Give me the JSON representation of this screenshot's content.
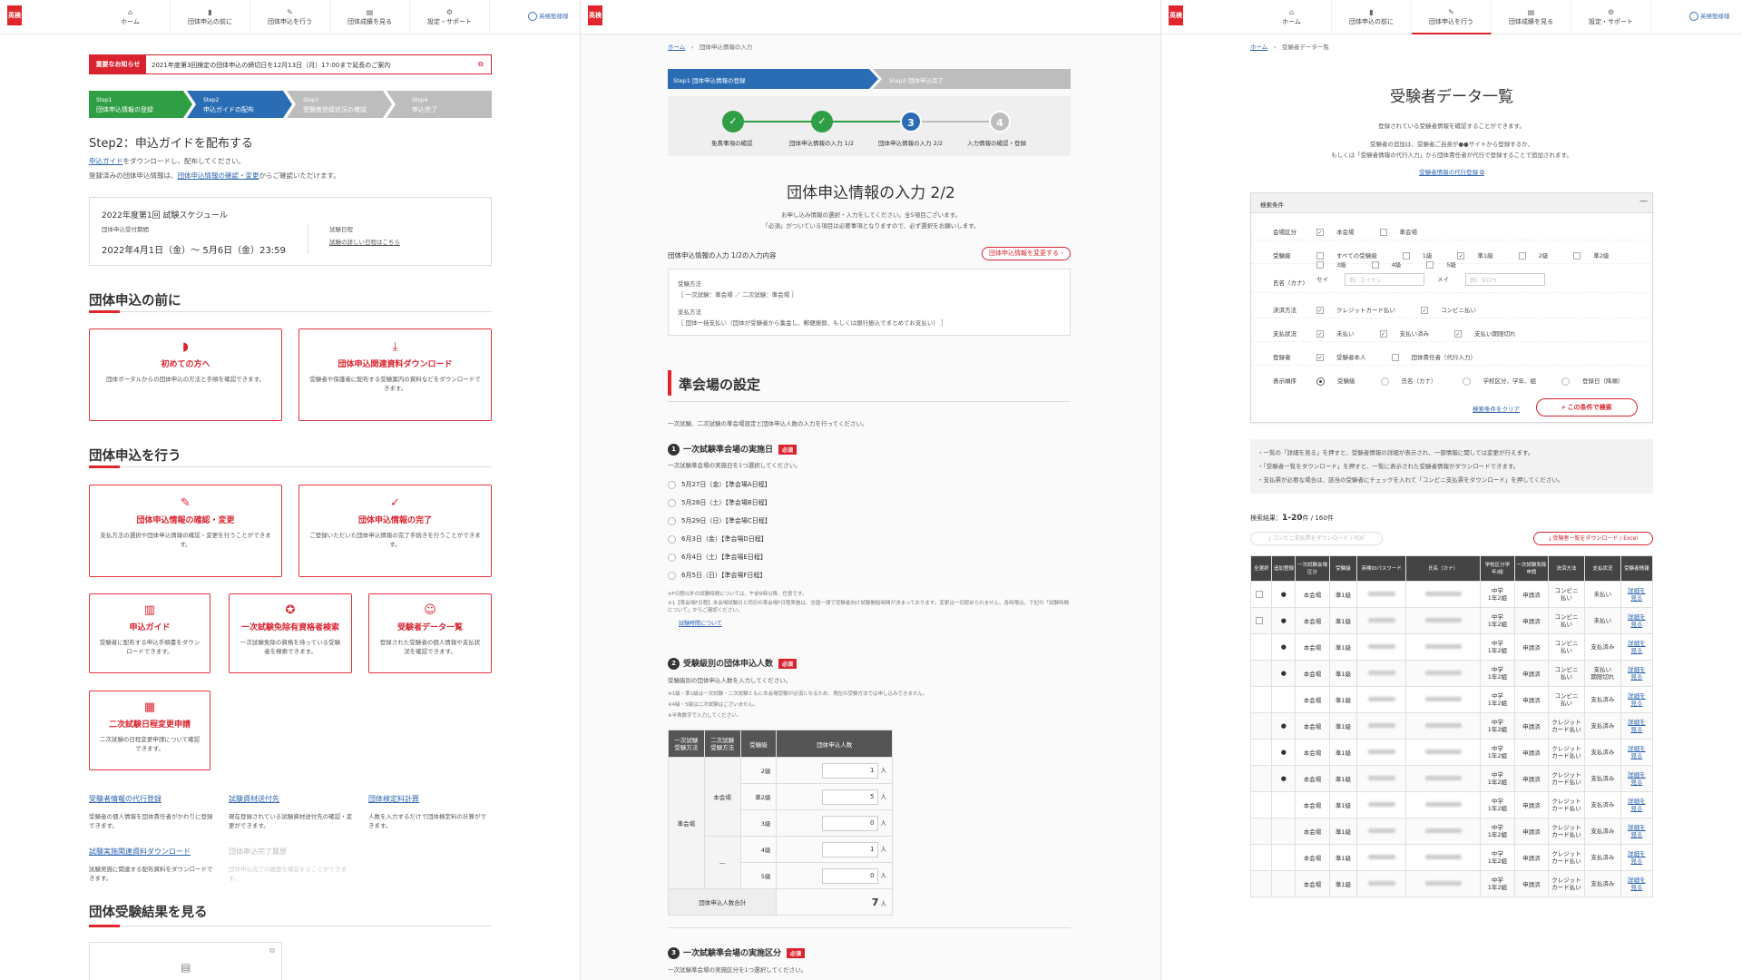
{
  "header": {
    "logo": "英検",
    "nav": [
      {
        "label": "ホーム",
        "icon": "home-icon",
        "glyph": "⌂"
      },
      {
        "label": "団体申込の前に",
        "icon": "book-icon",
        "glyph": "▮"
      },
      {
        "label": "団体申込を行う",
        "icon": "edit-icon",
        "glyph": "✎"
      },
      {
        "label": "団体成績を見る",
        "icon": "clipboard-icon",
        "glyph": "▤"
      },
      {
        "label": "設定・サポート",
        "icon": "gear-icon",
        "glyph": "⚙"
      }
    ],
    "user": "英検塾様様"
  },
  "p1": {
    "notice_label": "重要なお知らせ",
    "notice_msg": "2021年度第3回検定の団体申込の締切日を12月13日（月）17:00まで延長のご案内",
    "steps": [
      {
        "num": "Step1",
        "label": "団体申込情報の登録"
      },
      {
        "num": "Step2",
        "label": "申込ガイドの配布"
      },
      {
        "num": "Step3",
        "label": "受験者登録状況の確認"
      },
      {
        "num": "Step4",
        "label": "申込完了"
      }
    ],
    "title": "Step2：申込ガイドを配布する",
    "line1_link": "申込ガイド",
    "line1_rest": "をダウンロードし、配布してください。",
    "line2_pre": "登録済みの団体申込情報は、",
    "line2_link": "団体申込情報の確認・変更",
    "line2_post": "からご確認いただけます。",
    "sched_title": "2022年度第1回 試験スケジュール",
    "sched_period_label": "団体申込受付期間",
    "sched_period": "2022年4月1日（金）～ 5月6日（金）23:59",
    "sched_exam_label": "試験日程",
    "sched_exam_link": "試験の詳しい日程はこちら",
    "sec1": "団体申込の前に",
    "cards1": [
      {
        "label": "初めての方へ",
        "desc": "団体ポータルからの団体申込の方法と手順を確認できます。",
        "icon": "◗"
      },
      {
        "label": "団体申込関連資料ダウンロード",
        "desc": "受験者や保護者に配布する受験案内の資料などをダウンロードできます。",
        "icon": "⤓"
      }
    ],
    "sec2": "団体申込を行う",
    "cards2": [
      {
        "label": "団体申込情報の確認・変更",
        "desc": "支払方法の選択や団体申込情報の確認・変更を行うことができます。",
        "icon": "✎"
      },
      {
        "label": "団体申込情報の完了",
        "desc": "ご登録いただいた団体申込情報の完了手続きを行うことができます。",
        "icon": "✓"
      }
    ],
    "cards3": [
      {
        "label": "申込ガイド",
        "desc": "受験者に配布する申込手順書をダウンロードできます。",
        "icon": "▥"
      },
      {
        "label": "一次試験免除有資格者検索",
        "desc": "一次試験免除の資格を持っている受験者を検索できます。",
        "icon": "✪"
      },
      {
        "label": "受験者データ一覧",
        "desc": "登録された受験者の個人情報や支払状況を確認できます。",
        "icon": "☺"
      }
    ],
    "card4": {
      "label": "二次試験日程変更申請",
      "desc": "二次試験の日程変更申請について確認できます。",
      "icon": "▦"
    },
    "links": [
      {
        "label": "受験者情報の代行登録",
        "desc": "受験者の個人情報を団体責任者がかわりに登録できます。"
      },
      {
        "label": "試験資材送付先",
        "desc": "現在登録されている試験資材送付先の確認・変更ができます。"
      },
      {
        "label": "団体検定料計算",
        "desc": "人数を入力するだけで団体検定料の計算ができます。"
      },
      {
        "label": "試験実施関連資料ダウンロード",
        "desc": "試験実施に関連する配布資料をダウンロードできます。"
      },
      {
        "label": "団体申込完了履歴",
        "desc": "団体申込完了の履歴を確認することができます。"
      }
    ],
    "sec3": "団体受験結果を見る"
  },
  "p2": {
    "crumb_home": "ホーム",
    "crumb_cur": "団体申込情報の入力",
    "step_a": "Step1 団体申込情報の登録",
    "step_b": "Step2 団体申込完了",
    "progress": [
      {
        "label": "免責事項の確認",
        "state": "done"
      },
      {
        "label": "団体申込情報の入力 1/2",
        "state": "done"
      },
      {
        "label": "団体申込情報の入力 2/2",
        "state": "current",
        "num": "3"
      },
      {
        "label": "入力情報の確認・登録",
        "state": "todo",
        "num": "4"
      }
    ],
    "title": "団体申込情報の入力 2/2",
    "intro1": "お申し込み情報の選択・入力をしてください。全5項目ございます。",
    "intro2": "「必須」がついている項目は必要事項となりますので、必ず選択をお願いします。",
    "summary_label": "団体申込情報の入力 1/2の入力内容",
    "summary_btn": "団体申込情報を変更する",
    "sum1_label": "受験方法",
    "sum1_val": "［ 一次試験：準会場 ／ 二次試験：準会場 ］",
    "sum2_label": "支払方法",
    "sum2_val": "［ 団体一括支払い（団体が受験者から集金し、郵便振替、もしくは銀行振込でまとめてお支払い） ］",
    "section": "準会場の設定",
    "section_desc": "一次試験、二次試験の準会場設定と団体申込人数の入力を行ってください。",
    "q1_num": "1",
    "q1": "一次試験準会場の実施日",
    "q1_desc": "一次試験準会場の実施日を1つ選択してください。",
    "required": "必須",
    "dates": [
      "5月27日（金）【準会場A日程】",
      "5月28日（土）【準会場B日程】",
      "5月29日（日）【準会場C日程】",
      "6月3日（金）【準会場D日程】",
      "6月4日（土）【準会場E日程】",
      "6月5日（日）【準会場F日程】"
    ],
    "note1": "※F日程以外の試験時間については、午前9時以降、任意です。",
    "note2": "※1【準会場F日程】本会場試験日と同日の準会場F日程実施は、全国一律で受験者向け試験開始時間が決まっております。変更は一切認められません。各時限は、下記の「試験時間について」からご確認ください。",
    "note_link": "試験時間について",
    "q2_num": "2",
    "q2": "受験級別の団体申込人数",
    "q2_desc": "受験級別の団体申込人数を入力してください。",
    "q2_n1": "※1級・準1級は一次試験・二次試験ともに本会場受験が必須となるため、現在の受験方法では申し込みできません。",
    "q2_n2": "※4級・5級は二次試験はございません。",
    "q2_n3": "※半角数字で入力してください。",
    "table_headers": [
      "一次試験\n受験方法",
      "二次試験\n受験方法",
      "受験級",
      "団体申込人数"
    ],
    "col1": "準会場",
    "col2a": "本会場",
    "col2b": "—",
    "rows": [
      {
        "grade": "2級",
        "count": "1"
      },
      {
        "grade": "準2級",
        "count": "5"
      },
      {
        "grade": "3級",
        "count": "0"
      },
      {
        "grade": "4級",
        "count": "1"
      },
      {
        "grade": "5級",
        "count": "0"
      }
    ],
    "unit": "人",
    "total_label": "団体申込人数合計",
    "total": "7",
    "q3_num": "3",
    "q3": "一次試験準会場の実施区分",
    "q3_desc": "一次試験準会場の実施区分を1つ選択してください。"
  },
  "p3": {
    "crumb_home": "ホーム",
    "crumb_cur": "受験者データ一覧",
    "title": "受験者データ一覧",
    "d1": "登録されている受験者情報を確認することができます。",
    "d2": "受験者の追加は、受験者ご自身が●●サイトから登録するか、",
    "d3": "もしくは「受験者情報の代行入力」から団体責任者が代行で登録することで追加されます。",
    "d_link": "受験者情報の代行登録",
    "filter_title": "検索条件",
    "collapse": "—",
    "f_venue": "会場区分",
    "f_venue_opts": [
      "本会場",
      "準会場"
    ],
    "f_grade": "受験級",
    "f_grade_opts": [
      "すべての受験級",
      "1級",
      "準1級",
      "2級",
      "準2級",
      "3級",
      "4級",
      "5級"
    ],
    "f_name": "氏名（カナ）",
    "f_sei": "セイ",
    "f_sei_ph": "例）エイケン",
    "f_mei": "メイ",
    "f_mei_ph": "例）タロウ",
    "f_pay": "決済方法",
    "f_pay_opts": [
      "クレジットカード払い",
      "コンビニ払い"
    ],
    "f_status": "支払状況",
    "f_status_opts": [
      "未払い",
      "支払い済み",
      "支払い期限切れ"
    ],
    "f_reg": "登録者",
    "f_reg_opts": [
      "受験者本人",
      "団体責任者（代行入力）"
    ],
    "f_order": "表示順序",
    "f_order_opts": [
      "受験級",
      "氏名（カナ）",
      "学校区分、学年、組",
      "登録日（降順）"
    ],
    "clear": "検索条件をクリア",
    "search": "この条件で検索",
    "info1": "・一覧の「詳細を見る」を押すと、受験者情報の詳細が表示され、一部情報に関しては変更が行えます。",
    "info2": "・「受験者一覧をダウンロード」を押すと、一覧に表示された受験者情報がダウンロードできます。",
    "info3": "・支払票が必要な場合は、該当の受験者にチェックを入れて「コンビニ支払票をダウンロード」を押してください。",
    "result_label": "検索結果：",
    "result_range": "1-20",
    "result_total": "件 / 160件",
    "btn_conv": "コンビニ支払票をダウンロード / PDF",
    "btn_dl": "受験者一覧をダウンロード / Excel",
    "headers": [
      "全選択",
      "追加登録",
      "一次試験会場区分",
      "受験級",
      "英検IDパスワード",
      "氏名（カナ）",
      "学校区分学年/組",
      "一次試験免除申請",
      "決済方法",
      "支払状況",
      "受験者情報"
    ],
    "rows": [
      {
        "chk": true,
        "dot": true,
        "venue": "本会場",
        "grade": "準1級",
        "school": "中学\n1年2組",
        "exempt": "申請済",
        "pay": "コンビニ\n払い",
        "status": "未払い",
        "link": "詳細を\n見る"
      },
      {
        "chk": true,
        "dot": true,
        "venue": "本会場",
        "grade": "準1級",
        "school": "中学\n1年2組",
        "exempt": "申請済",
        "pay": "コンビニ\n払い",
        "status": "未払い",
        "link": "詳細を\n見る"
      },
      {
        "chk": false,
        "dot": true,
        "venue": "本会場",
        "grade": "準1級",
        "school": "中学\n1年2組",
        "exempt": "申請済",
        "pay": "コンビニ\n払い",
        "status": "支払済み",
        "link": "詳細を\n見る"
      },
      {
        "chk": false,
        "dot": true,
        "venue": "本会場",
        "grade": "準1級",
        "school": "中学\n1年2組",
        "exempt": "申請済",
        "pay": "コンビニ\n払い",
        "status": "支払い\n期限切れ",
        "link": "詳細を\n見る"
      },
      {
        "chk": false,
        "dot": false,
        "venue": "本会場",
        "grade": "準1級",
        "school": "中学\n1年2組",
        "exempt": "申請済",
        "pay": "コンビニ\n払い",
        "status": "支払済み",
        "link": "詳細を\n見る"
      },
      {
        "chk": false,
        "dot": true,
        "venue": "本会場",
        "grade": "準1級",
        "school": "中学\n1年2組",
        "exempt": "申請済",
        "pay": "クレジット\nカード払い",
        "status": "支払済み",
        "link": "詳細を\n見る"
      },
      {
        "chk": false,
        "dot": true,
        "venue": "本会場",
        "grade": "準1級",
        "school": "中学\n1年2組",
        "exempt": "申請済",
        "pay": "クレジット\nカード払い",
        "status": "支払済み",
        "link": "詳細を\n見る"
      },
      {
        "chk": false,
        "dot": true,
        "venue": "本会場",
        "grade": "準1級",
        "school": "中学\n1年2組",
        "exempt": "申請済",
        "pay": "クレジット\nカード払い",
        "status": "支払済み",
        "link": "詳細を\n見る"
      },
      {
        "chk": false,
        "dot": false,
        "venue": "本会場",
        "grade": "準1級",
        "school": "中学\n1年2組",
        "exempt": "申請済",
        "pay": "クレジット\nカード払い",
        "status": "支払済み",
        "link": "詳細を\n見る"
      },
      {
        "chk": false,
        "dot": false,
        "venue": "本会場",
        "grade": "準1級",
        "school": "中学\n1年2組",
        "exempt": "申請済",
        "pay": "クレジット\nカード払い",
        "status": "支払済み",
        "link": "詳細を\n見る"
      },
      {
        "chk": false,
        "dot": false,
        "venue": "本会場",
        "grade": "準1級",
        "school": "中学\n1年2組",
        "exempt": "申請済",
        "pay": "クレジット\nカード払い",
        "status": "支払済み",
        "link": "詳細を\n見る"
      },
      {
        "chk": false,
        "dot": false,
        "venue": "本会場",
        "grade": "準1級",
        "school": "中学\n1年2組",
        "exempt": "申請済",
        "pay": "クレジット\nカード払い",
        "status": "支払済み",
        "link": "詳細を\n見る"
      }
    ]
  },
  "colors": {
    "brand": "#e0262c",
    "step_done": "#2f9e44",
    "step_current": "#2a6db5",
    "step_todo": "#bdbdbd",
    "link": "#2a63b0"
  }
}
